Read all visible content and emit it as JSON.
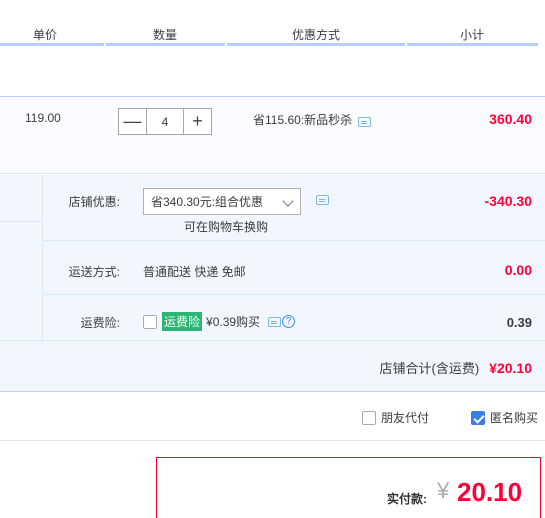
{
  "header": {
    "unit_price": "单价",
    "quantity": "数量",
    "discount": "优惠方式",
    "subtotal": "小计"
  },
  "item": {
    "price": "119.00",
    "quantity": "4",
    "minus": "—",
    "plus": "+",
    "promo": "省115.60:新品秒杀",
    "subtotal": "360.40"
  },
  "shop": {
    "discount_label": "店铺优惠:",
    "discount_select": "省340.30元:组合优惠",
    "discount_hint": "可在购物车换购",
    "discount_value": "-340.30",
    "shipping_label": "运送方式:",
    "shipping_text": "普通配送 快递 免邮",
    "shipping_value": "0.00",
    "insurance_label": "运费险:",
    "insurance_tag": "运费险",
    "insurance_text": "¥0.39购买",
    "insurance_value": "0.39",
    "total_label": "店铺合计(含运费)",
    "total_value": "¥20.10"
  },
  "options": {
    "friend_pay": "朋友代付",
    "friend_pay_checked": false,
    "anonymous": "匿名购买",
    "anonymous_checked": true
  },
  "payment": {
    "label": "实付款:",
    "currency": "¥",
    "amount": "20.10"
  },
  "colors": {
    "accent_red": "#ff0036",
    "accent_blue": "#3c8ee6",
    "tag_green": "#2bb673"
  }
}
